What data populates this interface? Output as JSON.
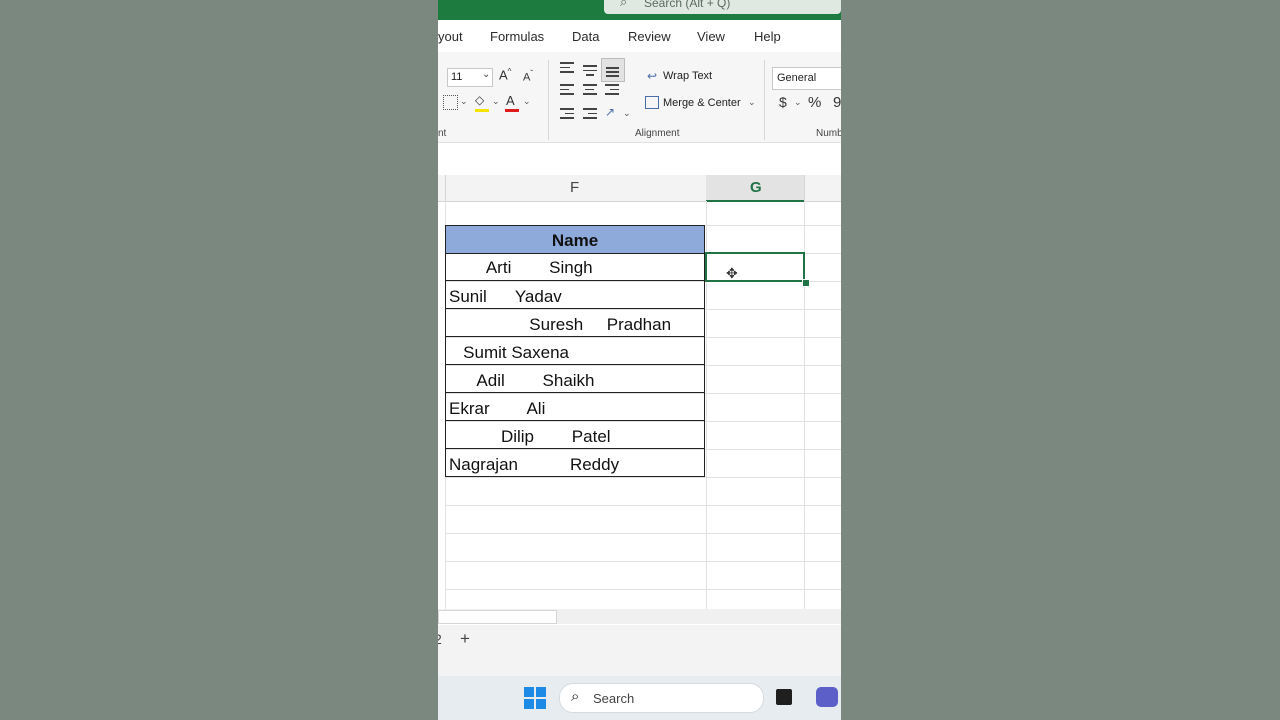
{
  "titlebar": {
    "search_placeholder": "Search (Alt + Q)"
  },
  "menu": {
    "tabs": [
      "yout",
      "Formulas",
      "Data",
      "Review",
      "View",
      "Help"
    ]
  },
  "ribbon": {
    "font_size": "11",
    "wrap_text": "Wrap Text",
    "merge_center": "Merge & Center",
    "alignment_group": "Alignment",
    "font_group_fragment": "nt",
    "number_format": "General",
    "number_group_fragment": "Numb",
    "currency_symbol": "$",
    "percent_symbol": "%",
    "comma_fragment": "9"
  },
  "grid": {
    "columns": [
      "F",
      "G"
    ],
    "header_cell": "Name",
    "names": [
      "        Arti        Singh",
      "Sunil      Yadav",
      "                 Suresh     Pradhan",
      "   Sumit Saxena",
      "      Adil        Shaikh",
      "Ekrar        Ali",
      "           Dilip        Patel",
      "Nagrajan           Reddy"
    ]
  },
  "sheetbar": {
    "sheet_fragment": "2",
    "add_sheet": "+"
  },
  "taskbar": {
    "search_label": "Search"
  },
  "colors": {
    "accent": "#1e7b3f",
    "header_fill": "#8eaadb",
    "selection": "#217346"
  }
}
